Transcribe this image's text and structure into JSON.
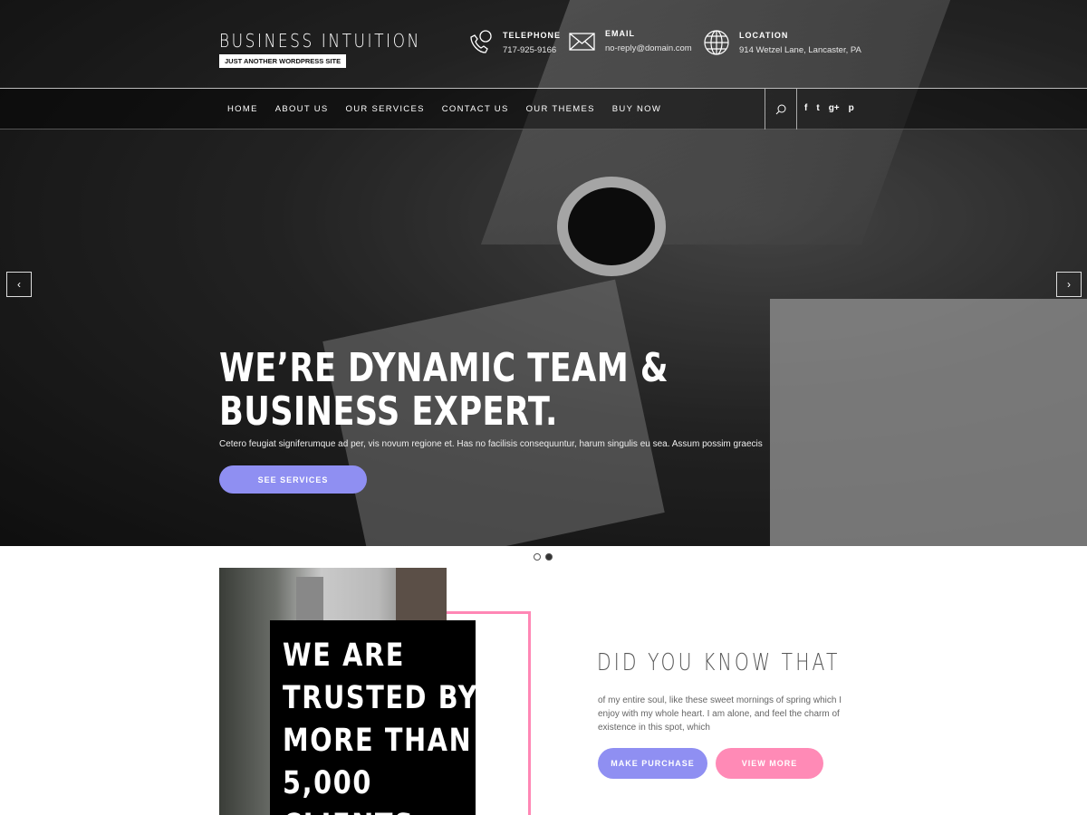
{
  "header": {
    "site_name": "BUSINESS INTUITION",
    "tagline": "JUST ANOTHER WORDPRESS SITE",
    "contacts": [
      {
        "icon": "phone-chat-icon",
        "title": "TELEPHONE",
        "value": "717-925-9166"
      },
      {
        "icon": "envelope-icon",
        "title": "EMAIL",
        "value": "no-reply@domain.com"
      },
      {
        "icon": "globe-icon",
        "title": "LOCATION",
        "value": "914 Wetzel Lane, Lancaster, PA"
      }
    ]
  },
  "nav": {
    "items": [
      "HOME",
      "ABOUT US",
      "OUR SERVICES",
      "CONTACT US",
      "OUR THEMES",
      "BUY NOW"
    ],
    "social": [
      "f",
      "t",
      "g+",
      "p"
    ]
  },
  "hero": {
    "headline_1": "WE’RE DYNAMIC TEAM &",
    "headline_2": "BUSINESS EXPERT.",
    "subtext": "Cetero feugiat signiferumque ad per, vis novum regione et. Has no facilisis consequuntur, harum singulis eu sea. Assum possim graecis",
    "button": "SEE SERVICES",
    "prev": "‹",
    "next": "›",
    "active_slide": 2,
    "slide_count": 2
  },
  "trusted": {
    "lines": [
      "WE ARE",
      "TRUSTED BY",
      "MORE THAN",
      "5,000",
      "CLIENTS"
    ]
  },
  "info": {
    "title": "DID YOU KNOW THAT",
    "text": "of my entire soul, like these sweet mornings of spring which I enjoy with my whole heart. I am alone, and feel the charm of existence in this spot, which",
    "purchase": "MAKE PURCHASE",
    "more": "VIEW MORE"
  },
  "colors": {
    "accent_purple": "#8f8ff2",
    "accent_pink": "#ff8ab6"
  }
}
